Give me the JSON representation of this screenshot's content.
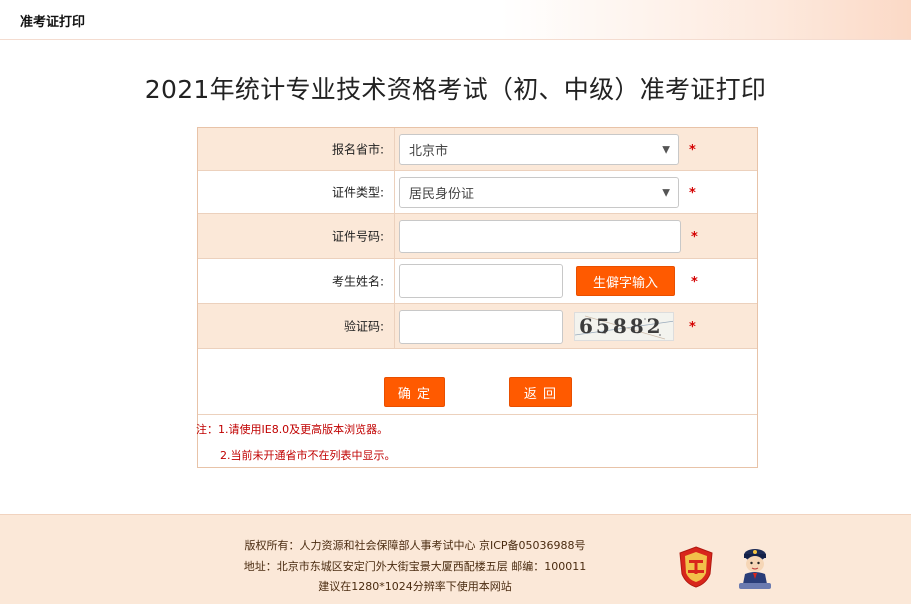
{
  "header": {
    "title": "准考证打印"
  },
  "page_title": "2021年统计专业技术资格考试（初、中级）准考证打印",
  "form": {
    "province": {
      "label": "报名省市:",
      "value": "北京市"
    },
    "id_type": {
      "label": "证件类型:",
      "value": "居民身份证"
    },
    "id_number": {
      "label": "证件号码:",
      "value": ""
    },
    "name": {
      "label": "考生姓名:",
      "value": "",
      "rare_char_button": "生僻字输入"
    },
    "captcha": {
      "label": "验证码:",
      "value": "",
      "image_text": "65882"
    },
    "required_mark": "*"
  },
  "buttons": {
    "confirm": "确 定",
    "back": "返 回"
  },
  "notes": {
    "line1": "注：1.请使用IE8.0及更高版本浏览器。",
    "line2": "2.当前未开通省市不在列表中显示。"
  },
  "footer": {
    "copyright": "版权所有：人力资源和社会保障部人事考试中心  京ICP备05036988号",
    "address": "地址：北京市东城区安定门外大街宝景大厦西配楼五层  邮编：100011",
    "resolution": "建议在1280*1024分辨率下使用本网站"
  },
  "colors": {
    "accent": "#ff5a00",
    "row_tint": "#fbe8d8",
    "required": "#d40000"
  }
}
